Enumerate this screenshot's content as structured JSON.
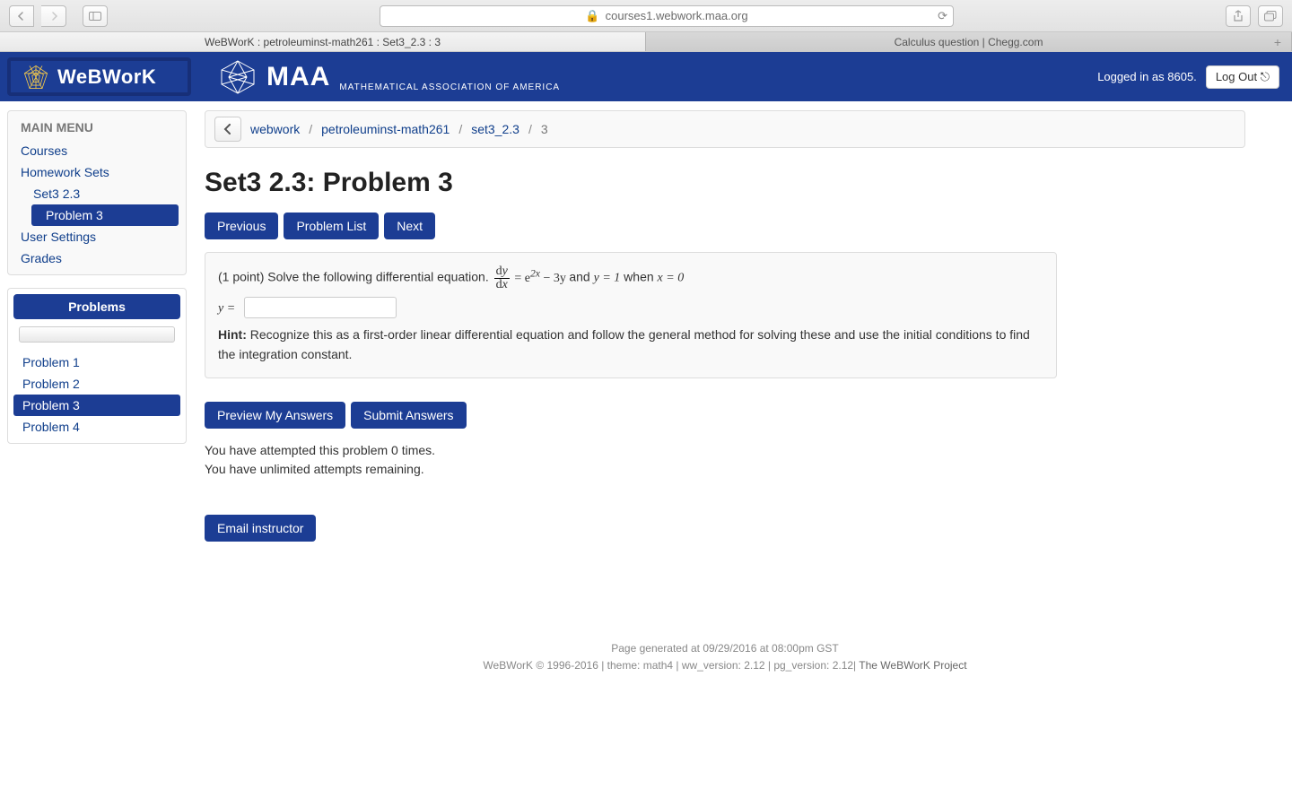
{
  "browser": {
    "address": "courses1.webwork.maa.org",
    "tabs": [
      {
        "label": "WeBWorK : petroleuminst-math261 : Set3_2.3 : 3"
      },
      {
        "label": "Calculus question | Chegg.com"
      }
    ]
  },
  "header": {
    "brand": "WeBWorK",
    "maa": "MAA",
    "maa_sub": "MATHEMATICAL ASSOCIATION OF AMERICA",
    "logged_in": "Logged in as 8605.",
    "logout_label": "Log Out"
  },
  "sidebar": {
    "title": "MAIN MENU",
    "links": [
      {
        "label": "Courses"
      },
      {
        "label": "Homework Sets"
      },
      {
        "label": "Set3 2.3"
      },
      {
        "label": "Problem 3"
      },
      {
        "label": "User Settings"
      },
      {
        "label": "Grades"
      }
    ],
    "problems_header": "Problems",
    "problems": [
      "Problem 1",
      "Problem 2",
      "Problem 3",
      "Problem 4"
    ],
    "active_problem": "Problem 3"
  },
  "breadcrumb": {
    "items": [
      "webwork",
      "petroleuminst-math261",
      "set3_2.3"
    ],
    "current": "3"
  },
  "page": {
    "title": "Set3 2.3: Problem 3",
    "nav": {
      "prev": "Previous",
      "list": "Problem List",
      "next": "Next"
    },
    "problem": {
      "lead": "(1 point) Solve the following differential equation.",
      "frac_top": "dy",
      "frac_bot": "dx",
      "eq_rest_a": " = e",
      "exp": "2x",
      "eq_rest_b": " − 3y",
      "and": " and ",
      "cond1": "y = 1",
      "when": " when ",
      "cond2": "x = 0",
      "answer_label": "y =",
      "hint_label": "Hint:",
      "hint": " Recognize this as a first-order linear differential equation and follow the general method for solving these and use the initial conditions to find the integration constant."
    },
    "actions": {
      "preview": "Preview My Answers",
      "submit": "Submit Answers",
      "email": "Email instructor"
    },
    "attempts": {
      "line1": "You have attempted this problem 0 times.",
      "line2": "You have unlimited attempts remaining."
    }
  },
  "footer": {
    "line1": "Page generated at 09/29/2016 at 08:00pm GST",
    "line2_a": "WeBWorK © 1996-2016 | theme: math4 | ww_version: 2.12 | pg_version: 2.12| ",
    "line2_link": "The WeBWorK Project"
  }
}
